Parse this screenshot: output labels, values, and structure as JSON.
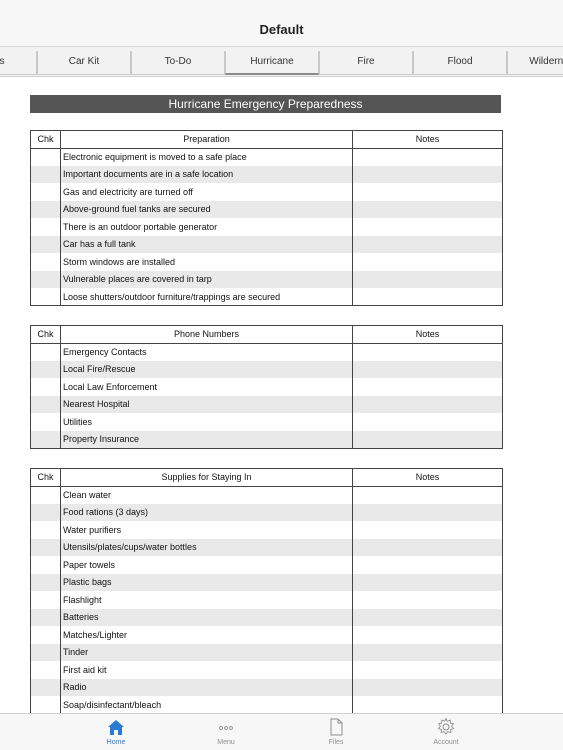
{
  "nav": {
    "title": "Default"
  },
  "tabs": [
    "Sports",
    "Car Kit",
    "To-Do",
    "Hurricane",
    "Fire",
    "Flood",
    "Wilderness"
  ],
  "active_tab": "Hurricane",
  "page_title": "Hurricane Emergency Preparedness",
  "sections": [
    {
      "col_chk": "Chk",
      "col_item": "Preparation",
      "col_notes": "Notes",
      "rows": [
        "Electronic equipment is moved to a safe place",
        "Important documents are in a safe location",
        "Gas and electricity are turned off",
        "Above-ground fuel tanks are secured",
        "There is an outdoor portable generator",
        "Car has a full tank",
        "Storm windows are installed",
        "Vulnerable places are covered in tarp",
        "Loose shutters/outdoor furniture/trappings are secured"
      ]
    },
    {
      "col_chk": "Chk",
      "col_item": "Phone Numbers",
      "col_notes": "Notes",
      "rows": [
        "Emergency Contacts",
        "Local Fire/Rescue",
        "Local Law Enforcement",
        "Nearest Hospital",
        "Utilities",
        "Property Insurance"
      ]
    },
    {
      "col_chk": "Chk",
      "col_item": "Supplies for Staying In",
      "col_notes": "Notes",
      "rows": [
        "Clean water",
        "Food rations (3 days)",
        "Water purifiers",
        "Utensils/plates/cups/water bottles",
        "Paper towels",
        "Plastic bags",
        "Flashlight",
        "Batteries",
        "Matches/Lighter",
        "Tinder",
        "First aid kit",
        "Radio",
        "Soap/disinfectant/bleach"
      ]
    }
  ],
  "tabbar": [
    {
      "label": "Home",
      "icon": "house-icon",
      "active": true
    },
    {
      "label": "Menu",
      "icon": "ellipsis-icon",
      "active": false
    },
    {
      "label": "Files",
      "icon": "document-icon",
      "active": false
    },
    {
      "label": "Account",
      "icon": "gear-icon",
      "active": false
    }
  ],
  "colors": {
    "accent": "#2a7ad2",
    "header_bar": "#555555",
    "row_stripe": "#e9e9e9"
  }
}
